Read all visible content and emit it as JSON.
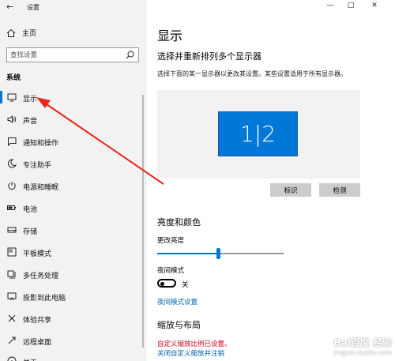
{
  "window": {
    "app_title": "设置",
    "controls": {
      "minimize": "—",
      "maximize": "□",
      "close": "✕"
    }
  },
  "sidebar": {
    "home_label": "主页",
    "search_placeholder": "查找设置",
    "section_label": "系统",
    "items": [
      {
        "label": "显示",
        "icon": "monitor-icon",
        "active": true
      },
      {
        "label": "声音",
        "icon": "speaker-icon"
      },
      {
        "label": "通知和操作",
        "icon": "notification-icon"
      },
      {
        "label": "专注助手",
        "icon": "moon-icon"
      },
      {
        "label": "电源和睡眠",
        "icon": "power-icon"
      },
      {
        "label": "电池",
        "icon": "battery-icon"
      },
      {
        "label": "存储",
        "icon": "storage-icon"
      },
      {
        "label": "平板模式",
        "icon": "tablet-icon"
      },
      {
        "label": "多任务处理",
        "icon": "multitask-icon"
      },
      {
        "label": "投影到此电脑",
        "icon": "project-icon"
      },
      {
        "label": "体验共享",
        "icon": "share-icon"
      },
      {
        "label": "远程桌面",
        "icon": "remote-icon"
      },
      {
        "label": "关于",
        "icon": "info-icon"
      }
    ]
  },
  "main": {
    "page_title": "显示",
    "arrange_title": "选择并重新排列多个显示器",
    "arrange_desc": "选择下面的某一显示器以更改其设置。某些设置适用于所有显示器。",
    "monitor_label": "1|2",
    "identify_button": "标识",
    "detect_button": "检测",
    "brightness_title": "亮度和颜色",
    "brightness_label": "更改亮度",
    "brightness_value": 0.48,
    "night_mode_label": "夜间模式",
    "night_mode_state": "关",
    "night_mode_link": "夜间模式设置",
    "scale_title": "缩放与布局",
    "custom_scale_link": "自定义缩放比例已设置。",
    "turn_off_scale_link": "关闭自定义缩放并注销"
  },
  "colors": {
    "accent": "#0078d7",
    "annotation_arrow": "#e8261c",
    "sidebar_bg": "#f2f2f2"
  },
  "watermark": {
    "logo": "Bai百度 经验",
    "url": "jingyan.baidu.com"
  }
}
